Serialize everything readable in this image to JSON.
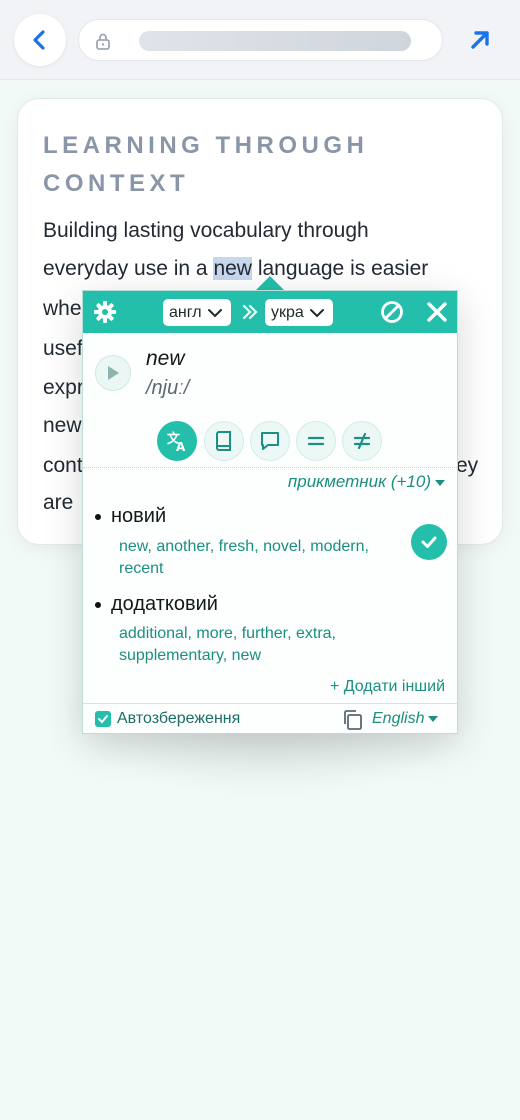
{
  "browser": {
    "back_icon": "chevron-left-icon",
    "lock_icon": "lock-icon",
    "share_icon": "arrow-up-right-icon"
  },
  "article": {
    "title": "LEARNING THROUGH CONTEXT",
    "lines": [
      "Building lasting vocabulary through",
      "everyday use in a",
      "new",
      " language is easier",
      "whe",
      "usef",
      "expr",
      "new",
      "cont",
      "ey",
      "are"
    ]
  },
  "popup": {
    "header": {
      "settings_icon": "gear-icon",
      "source_lang": "англ",
      "target_lang": "укра",
      "swap_icon": "double-chevron-right-icon",
      "block_icon": "block-icon",
      "close_icon": "close-icon"
    },
    "word": "new",
    "phonetic": "/njuː/",
    "tools": [
      "translate-icon",
      "book-icon",
      "comment-icon",
      "equals-icon",
      "not-equal-icon"
    ],
    "part_of_speech": "прикметник (+10)",
    "meanings": [
      {
        "word": "новий",
        "synonyms": "new, another, fresh, novel, modern, recent"
      },
      {
        "word": "додатковий",
        "synonyms": "additional, more, further, extra, supplementary, new"
      }
    ],
    "add_other": "+ Додати інший",
    "autosave_label": "Автозбереження",
    "autosave_checked": true,
    "interface_lang": "English"
  },
  "colors": {
    "accent": "#23bfaa",
    "accent_text": "#1b8f80",
    "title_gray": "#8a96a8",
    "link_blue": "#1a73e8"
  }
}
